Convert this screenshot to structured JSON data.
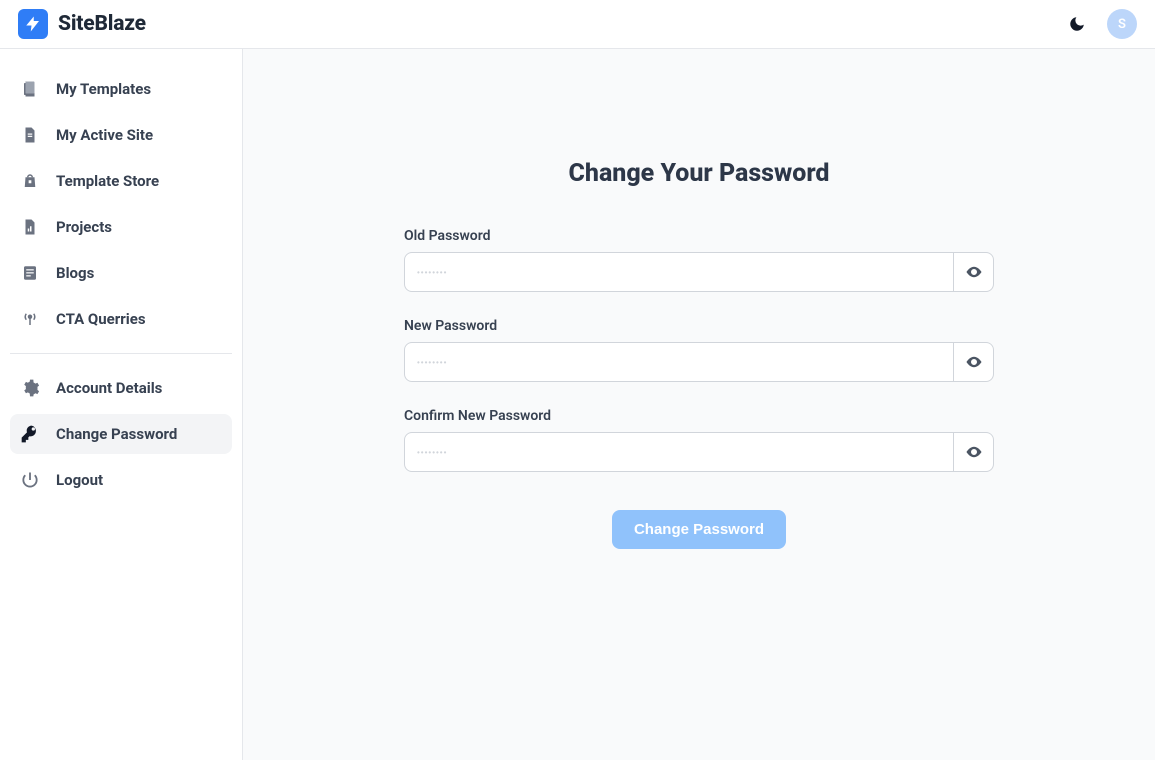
{
  "brand": {
    "title": "SiteBlaze"
  },
  "header": {
    "avatar_initial": "S"
  },
  "sidebar": {
    "primary": [
      {
        "label": "My Templates",
        "icon": "templates"
      },
      {
        "label": "My Active Site",
        "icon": "file"
      },
      {
        "label": "Template Store",
        "icon": "store"
      },
      {
        "label": "Projects",
        "icon": "chart"
      },
      {
        "label": "Blogs",
        "icon": "blog"
      },
      {
        "label": "CTA Querries",
        "icon": "broadcast"
      }
    ],
    "secondary": [
      {
        "label": "Account Details",
        "icon": "gear",
        "active": false
      },
      {
        "label": "Change Password",
        "icon": "key",
        "active": true
      },
      {
        "label": "Logout",
        "icon": "power",
        "active": false
      }
    ]
  },
  "page": {
    "title": "Change Your Password",
    "fields": {
      "old": {
        "label": "Old Password",
        "placeholder": "••••••••"
      },
      "new": {
        "label": "New Password",
        "placeholder": "••••••••"
      },
      "confirm": {
        "label": "Confirm New Password",
        "placeholder": "••••••••"
      }
    },
    "submit_label": "Change Password"
  }
}
